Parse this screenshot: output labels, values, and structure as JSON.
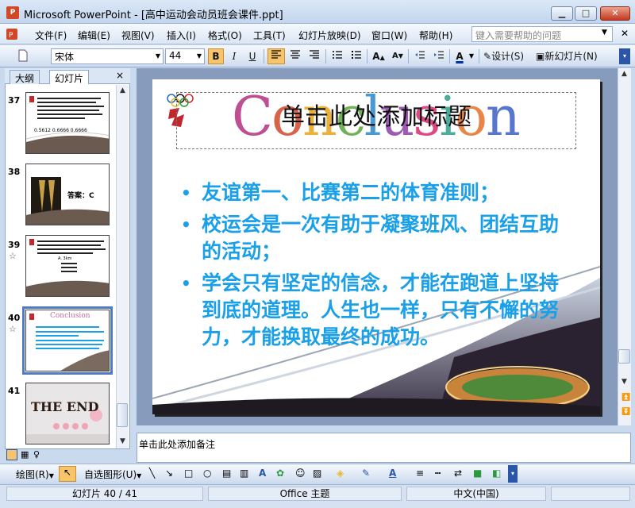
{
  "window": {
    "title": "Microsoft PowerPoint - [高中运动会动员班会课件.ppt]",
    "app_icon": "P",
    "minimize_icon": "minimize-icon",
    "maximize_icon": "maximize-icon",
    "close_icon": "close-icon"
  },
  "menu": {
    "items": [
      "文件(F)",
      "编辑(E)",
      "视图(V)",
      "插入(I)",
      "格式(O)",
      "工具(T)",
      "幻灯片放映(D)",
      "窗口(W)",
      "帮助(H)"
    ],
    "help_placeholder": "键入需要帮助的问题"
  },
  "toolbar": {
    "font_name": "宋体",
    "font_size": "44",
    "bold": "B",
    "italic": "I",
    "underline": "U",
    "design_label": "设计(S)",
    "new_slide_label": "新幻灯片(N)"
  },
  "left_pane": {
    "tabs": [
      "大纲",
      "幻灯片"
    ],
    "close": "×",
    "slides": [
      {
        "number": "37",
        "starred": false,
        "caption": "0.5612  0.6666  0.6666"
      },
      {
        "number": "38",
        "starred": false,
        "caption": "答案：C"
      },
      {
        "number": "39",
        "starred": true,
        "caption": "A. 3km"
      },
      {
        "number": "40",
        "starred": true,
        "caption": "Conclusion",
        "selected": true
      },
      {
        "number": "41",
        "starred": false,
        "caption": "THE END"
      }
    ]
  },
  "slide": {
    "art_letters": [
      "C",
      "o",
      "n",
      "c",
      "l",
      "u",
      "s",
      "i",
      "o",
      "n"
    ],
    "art_colors": [
      "#b3317f",
      "#d14a2b",
      "#e8a317",
      "#5aa43a",
      "#2a89c9",
      "#8e3fa8",
      "#d62a6e",
      "#2e9e8a",
      "#e4702a",
      "#3c5fc2"
    ],
    "title": "单击此处添加标题",
    "bullets": [
      "友谊第一、比赛第二的体育准则；",
      "校运会是一次有助于凝聚班风、团结互助的活动；",
      "学会只有坚定的信念，才能在跑道上坚持到底的道理。人生也一样，只有不懈的努力，才能换取最终的成功。"
    ],
    "bullet_color": "#1aa0e8"
  },
  "notes": {
    "placeholder": "单击此处添加备注"
  },
  "drawing_toolbar": {
    "draw_label": "绘图(R)",
    "autoshapes_label": "自选图形(U)"
  },
  "status": {
    "slide_position": "幻灯片 40 / 41",
    "theme": "Office 主题",
    "language": "中文(中国)"
  }
}
